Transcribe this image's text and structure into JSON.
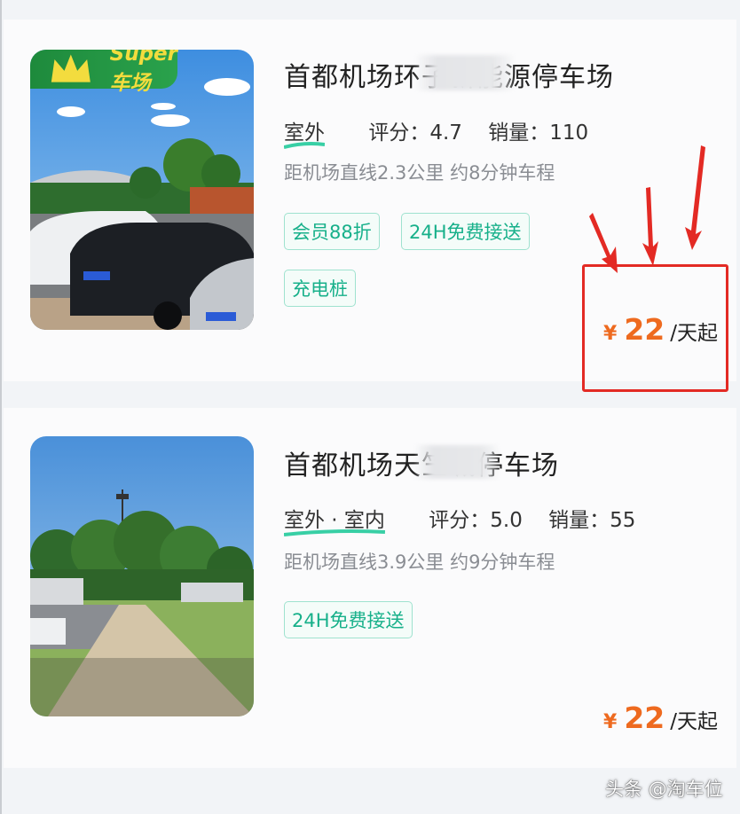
{
  "listings": [
    {
      "badge": "Super车场",
      "title": "首都机场环子新能源停车场",
      "area": "室外",
      "rating_label": "评分：",
      "rating": "4.7",
      "sales_label": "销量：",
      "sales": "110",
      "distance": "距机场直线2.3公里 约8分钟车程",
      "tags": [
        "会员88折",
        "24H免费接送",
        "充电桩"
      ],
      "price": {
        "currency": "¥",
        "amount": "22",
        "unit": "/天起"
      }
    },
    {
      "title": "首都机场天竺城停车场",
      "area": "室外 · 室内",
      "rating_label": "评分：",
      "rating": "5.0",
      "sales_label": "销量：",
      "sales": "55",
      "distance": "距机场直线3.9公里 约9分钟车程",
      "tags": [
        "24H免费接送"
      ],
      "price": {
        "currency": "¥",
        "amount": "22",
        "unit": "/天起"
      }
    }
  ],
  "watermark": "头条 @淘车位",
  "colors": {
    "accent_price": "#ee6a1f",
    "tag_green": "#17b08a",
    "highlight_red": "#e32a24",
    "badge_green": "#1e8a3c"
  }
}
